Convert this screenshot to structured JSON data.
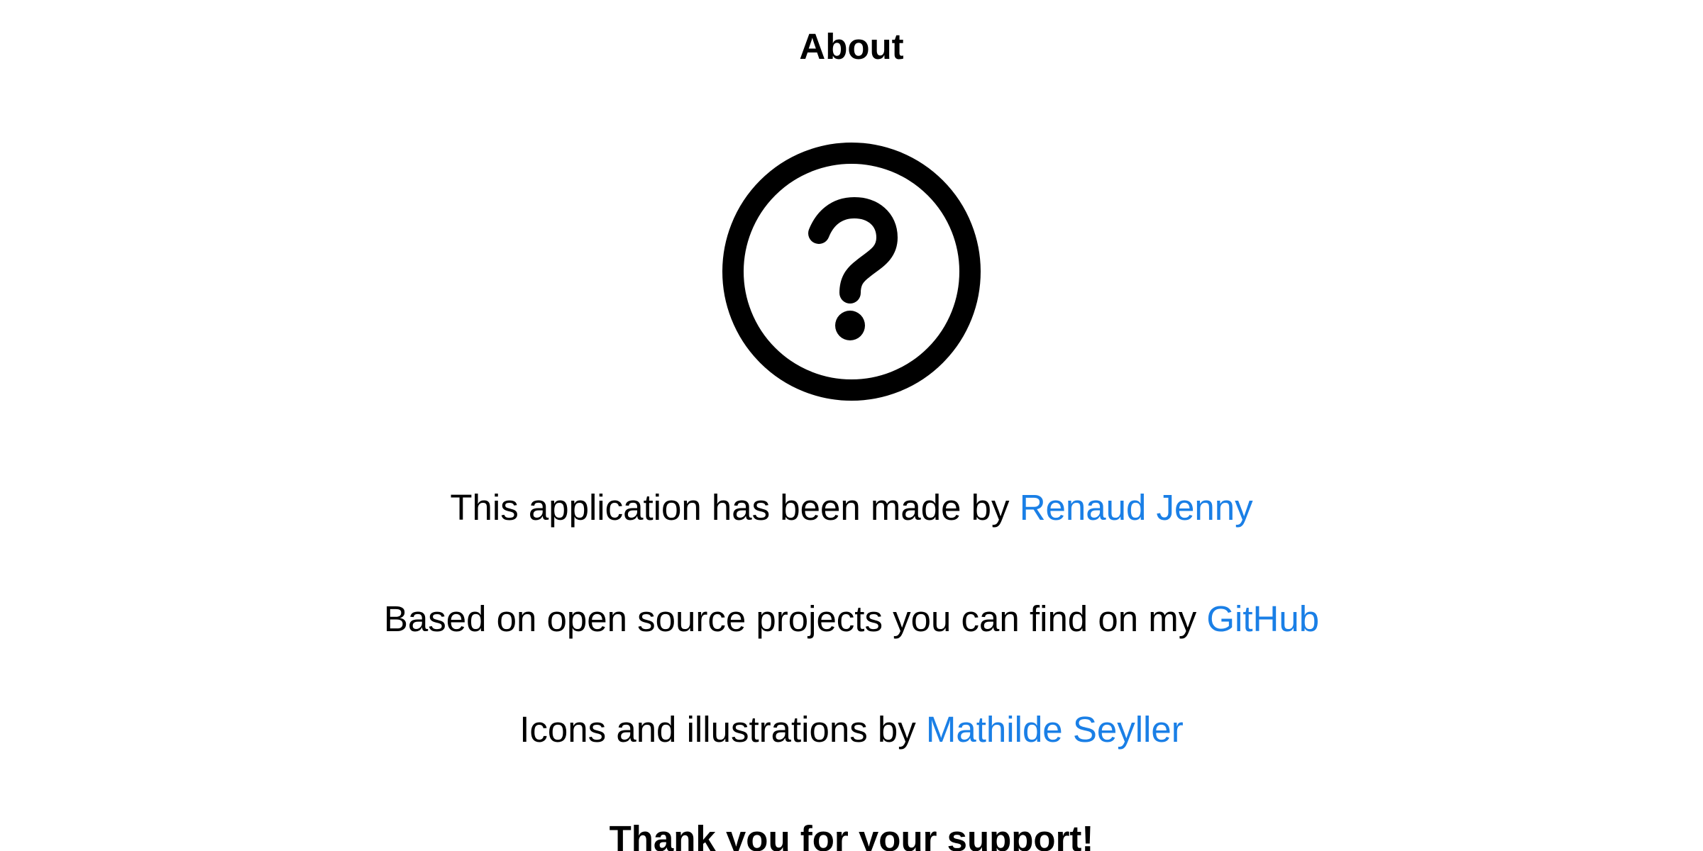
{
  "header": {
    "title": "About"
  },
  "icon": {
    "name": "help-circle-icon",
    "color": "#000000"
  },
  "credits": {
    "author_text": "This application has been made by ",
    "author_link": "Renaud Jenny",
    "source_text": "Based on open source projects you can find on my ",
    "source_link": "GitHub",
    "illustrations_text": "Icons and illustrations by ",
    "illustrations_link": "Mathilde Seyller",
    "thanks": "Thank you for your support!"
  },
  "colors": {
    "background": "#ffffff",
    "text": "#000000",
    "link": "#1a7fe6"
  }
}
